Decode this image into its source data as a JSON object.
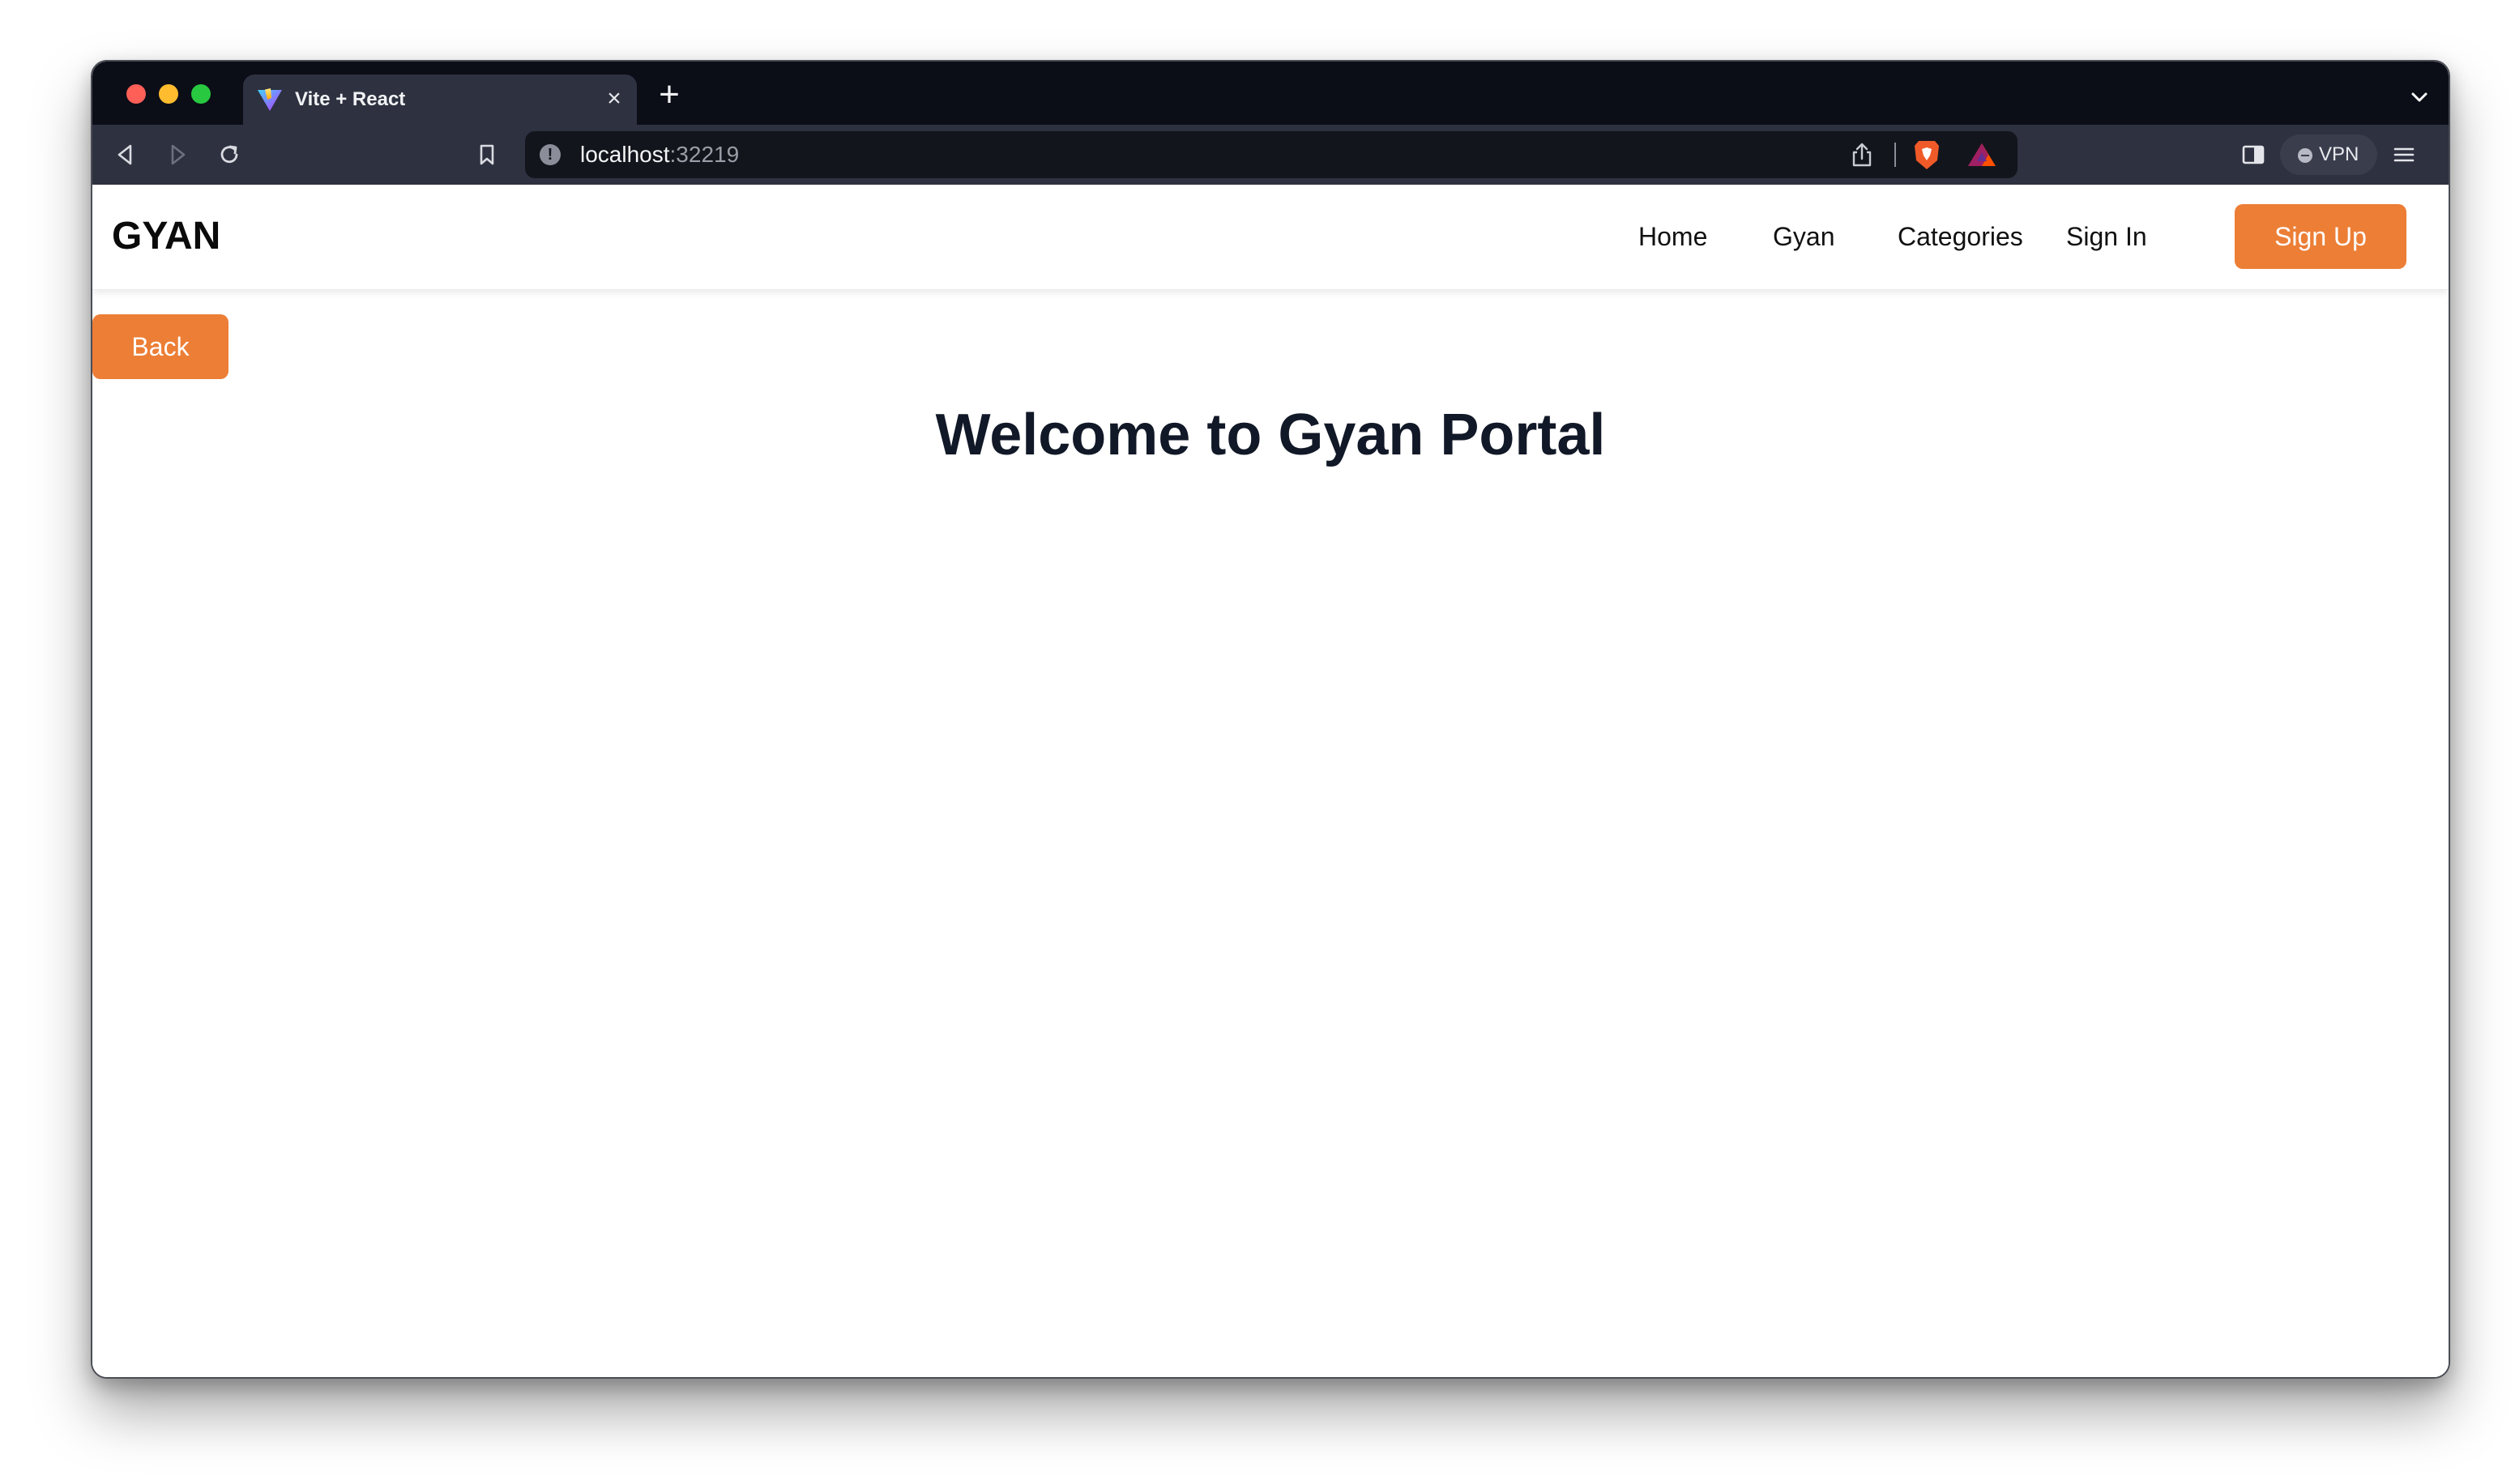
{
  "browser": {
    "tab": {
      "title": "Vite + React",
      "close_icon": "×"
    },
    "new_tab_icon": "+",
    "address_bar": {
      "host": "localhost",
      "port": ":32219"
    },
    "vpn_label": "VPN"
  },
  "site": {
    "brand": "GYAN",
    "nav": {
      "home": "Home",
      "gyan": "Gyan",
      "categories": "Categories",
      "sign_in": "Sign In",
      "sign_up": "Sign Up"
    },
    "back_label": "Back",
    "heading": "Welcome to Gyan Portal"
  },
  "colors": {
    "accent": "#ec7e36",
    "heading": "#111827",
    "tab_strip": "#0b0d17",
    "toolbar": "#2e3140"
  }
}
